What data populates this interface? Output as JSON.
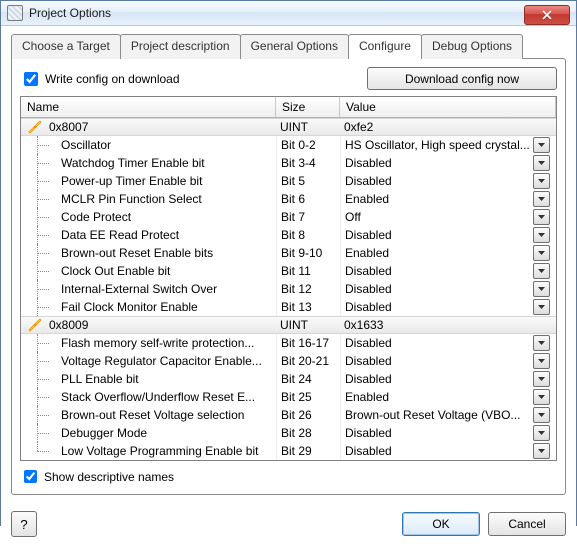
{
  "window": {
    "title": "Project Options"
  },
  "tabs": [
    {
      "label": "Choose a Target"
    },
    {
      "label": "Project description"
    },
    {
      "label": "General Options"
    },
    {
      "label": "Configure",
      "active": true
    },
    {
      "label": "Debug Options"
    }
  ],
  "configure": {
    "write_config_label": "Write config on download",
    "write_config_checked": true,
    "download_btn": "Download config now",
    "headers": {
      "name": "Name",
      "size": "Size",
      "value": "Value"
    },
    "show_descriptive_label": "Show descriptive names",
    "show_descriptive_checked": true,
    "groups": [
      {
        "name": "0x8007",
        "size": "UINT",
        "value": "0xfe2",
        "rows": [
          {
            "name": "Oscillator",
            "size": "Bit 0-2",
            "value": "HS Oscillator, High speed crystal..."
          },
          {
            "name": "Watchdog Timer Enable bit",
            "size": "Bit 3-4",
            "value": "Disabled"
          },
          {
            "name": "Power-up Timer Enable bit",
            "size": "Bit 5",
            "value": "Disabled"
          },
          {
            "name": "MCLR Pin Function Select",
            "size": "Bit 6",
            "value": "Enabled"
          },
          {
            "name": "Code Protect",
            "size": "Bit 7",
            "value": "Off"
          },
          {
            "name": "Data EE Read Protect",
            "size": "Bit 8",
            "value": "Disabled"
          },
          {
            "name": "Brown-out Reset Enable bits",
            "size": "Bit 9-10",
            "value": "Enabled"
          },
          {
            "name": "Clock Out Enable bit",
            "size": "Bit 11",
            "value": "Disabled"
          },
          {
            "name": "Internal-External Switch Over",
            "size": "Bit 12",
            "value": "Disabled"
          },
          {
            "name": "Fail Clock Monitor Enable",
            "size": "Bit 13",
            "value": "Disabled"
          }
        ]
      },
      {
        "name": "0x8009",
        "size": "UINT",
        "value": "0x1633",
        "rows": [
          {
            "name": "Flash memory self-write protection...",
            "size": "Bit 16-17",
            "value": "Disabled"
          },
          {
            "name": "Voltage Regulator Capacitor Enable...",
            "size": "Bit 20-21",
            "value": "Disabled"
          },
          {
            "name": "PLL Enable bit",
            "size": "Bit 24",
            "value": "Disabled"
          },
          {
            "name": "Stack Overflow/Underflow Reset E...",
            "size": "Bit 25",
            "value": "Enabled"
          },
          {
            "name": "Brown-out Reset Voltage selection",
            "size": "Bit 26",
            "value": "Brown-out Reset Voltage (VBO..."
          },
          {
            "name": "Debugger Mode",
            "size": "Bit 28",
            "value": "Disabled"
          },
          {
            "name": "Low Voltage Programming Enable bit",
            "size": "Bit 29",
            "value": "Disabled"
          }
        ]
      }
    ]
  },
  "footer": {
    "help": "?",
    "ok": "OK",
    "cancel": "Cancel"
  }
}
